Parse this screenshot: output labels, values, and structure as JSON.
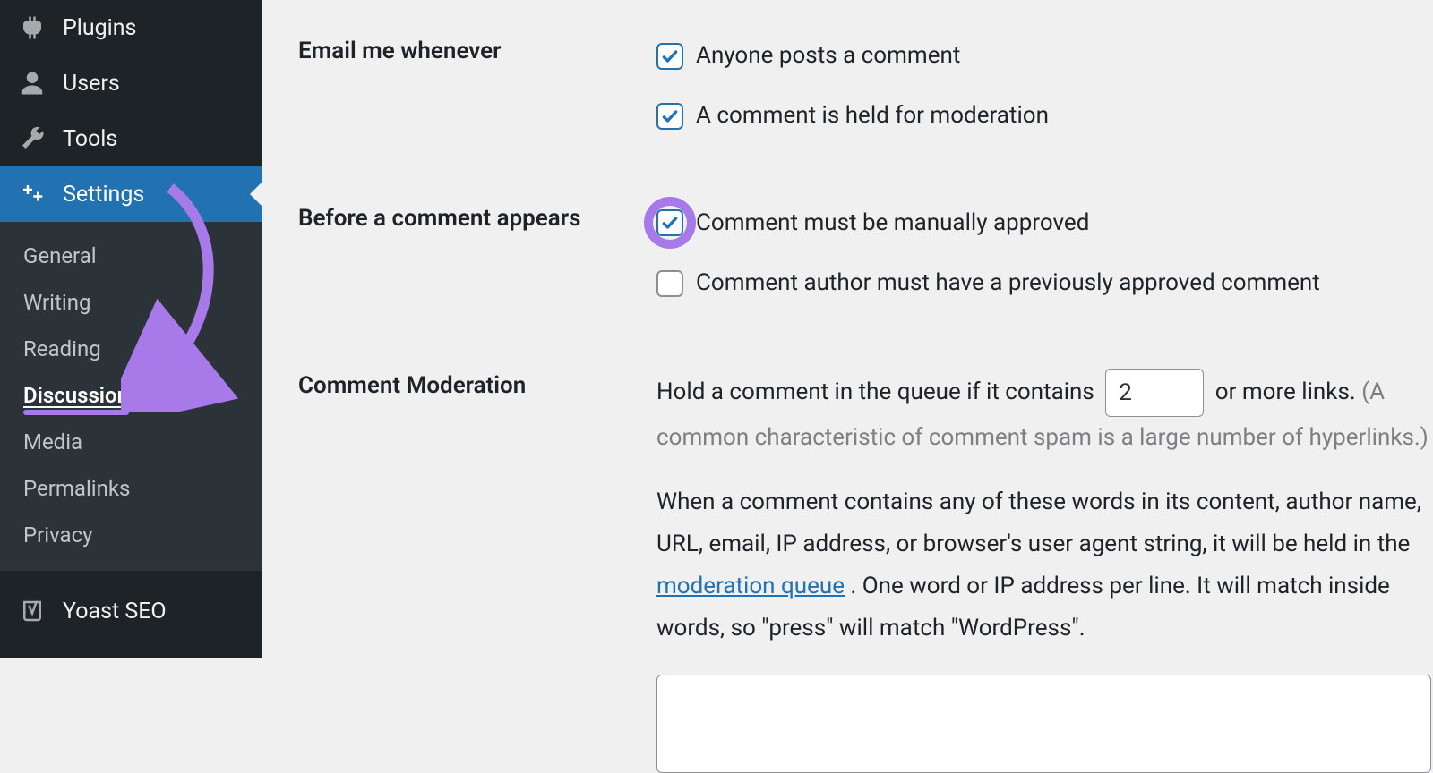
{
  "sidebar": {
    "items": [
      {
        "icon": "plugins",
        "label": "Plugins"
      },
      {
        "icon": "users",
        "label": "Users"
      },
      {
        "icon": "tools",
        "label": "Tools"
      },
      {
        "icon": "settings",
        "label": "Settings",
        "active": true
      }
    ],
    "submenu": [
      "General",
      "Writing",
      "Reading",
      "Discussion",
      "Media",
      "Permalinks",
      "Privacy"
    ],
    "submenu_current": "Discussion",
    "after": {
      "icon": "yoast",
      "label": "Yoast SEO"
    }
  },
  "sections": {
    "email": {
      "heading": "Email me whenever",
      "opt1": "Anyone posts a comment",
      "opt2": "A comment is held for moderation"
    },
    "before": {
      "heading": "Before a comment appears",
      "opt1": "Comment must be manually approved",
      "opt2": "Comment author must have a previously approved comment"
    },
    "moderation": {
      "heading": "Comment Moderation",
      "text_a": "Hold a comment in the queue if it contains ",
      "links_value": "2",
      "text_b": " or more links. ",
      "text_c": "(A common characteristic of comment spam is a large number of hyperlinks.)",
      "para2_a": "When a comment contains any of these words in its content, author name, URL, email, IP address, or browser's user agent string, it will be held in the ",
      "para2_link": "moderation queue",
      "para2_b": ". One word or IP address per line. It will match inside words, so \"press\" will match \"WordPress\"."
    }
  }
}
